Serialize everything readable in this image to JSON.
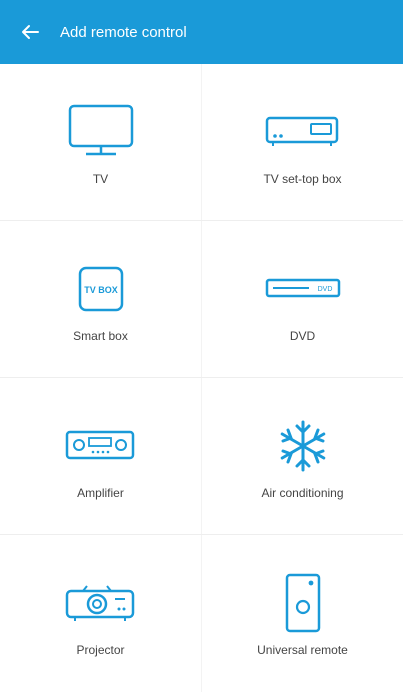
{
  "header": {
    "title": "Add remote control",
    "back_icon": "arrow-left-icon",
    "background": "#1a9ad8"
  },
  "devices": [
    {
      "label": "TV",
      "icon": "tv-icon"
    },
    {
      "label": "TV set-top box",
      "icon": "set-top-box-icon"
    },
    {
      "label": "Smart box",
      "icon": "smart-box-icon",
      "icon_text": "TV BOX"
    },
    {
      "label": "DVD",
      "icon": "dvd-icon",
      "icon_text": "DVD"
    },
    {
      "label": "Amplifier",
      "icon": "amplifier-icon"
    },
    {
      "label": "Air conditioning",
      "icon": "snowflake-icon"
    },
    {
      "label": "Projector",
      "icon": "projector-icon"
    },
    {
      "label": "Universal remote",
      "icon": "universal-remote-icon"
    }
  ],
  "colors": {
    "accent": "#1a9ad8"
  }
}
